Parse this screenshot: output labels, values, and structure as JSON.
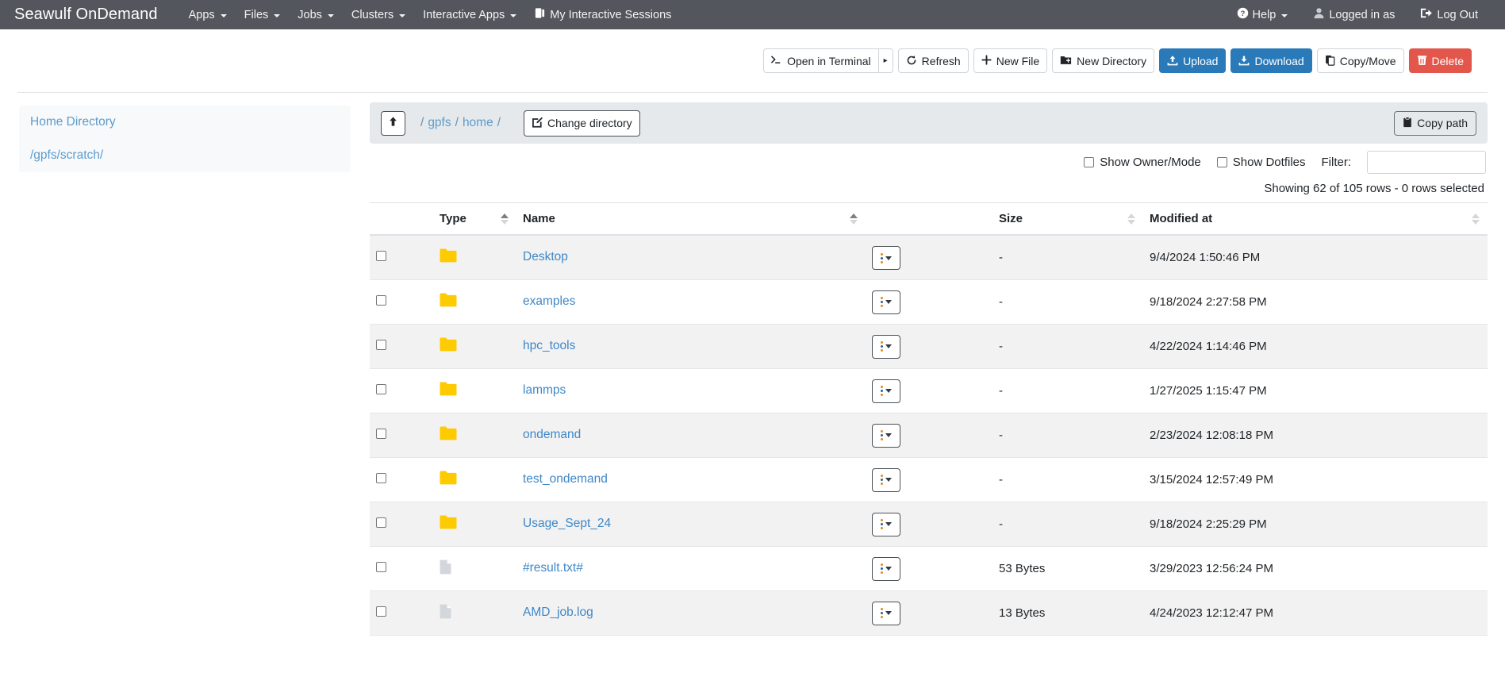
{
  "navbar": {
    "brand": "Seawulf OnDemand",
    "items": [
      {
        "label": "Apps",
        "has_caret": true,
        "icon": null
      },
      {
        "label": "Files",
        "has_caret": true,
        "icon": null
      },
      {
        "label": "Jobs",
        "has_caret": true,
        "icon": null
      },
      {
        "label": "Clusters",
        "has_caret": true,
        "icon": null
      },
      {
        "label": "Interactive Apps",
        "has_caret": true,
        "icon": null
      },
      {
        "label": "My Interactive Sessions",
        "has_caret": false,
        "icon": "sessions-icon"
      }
    ],
    "right_items": [
      {
        "label": "Help",
        "has_caret": true,
        "icon": "help-circle-icon"
      },
      {
        "label": "Logged in as",
        "has_caret": false,
        "icon": "user-icon"
      },
      {
        "label": "Log Out",
        "has_caret": false,
        "icon": "logout-icon"
      }
    ],
    "bg_color": "#53565c"
  },
  "toolbar": {
    "open_in_terminal": "Open in Terminal",
    "open_in_terminal_toggle": "▸",
    "refresh": "Refresh",
    "new_file": "New File",
    "new_directory": "New Directory",
    "upload": "Upload",
    "download": "Download",
    "copy_move": "Copy/Move",
    "delete": "Delete",
    "primary_color": "#2a7ab9",
    "danger_color": "#e3564c"
  },
  "sidebar": {
    "items": [
      {
        "label": "Home Directory"
      },
      {
        "label": "/gpfs/scratch/"
      }
    ]
  },
  "pathbar": {
    "up_icon": "arrow-up-icon",
    "crumbs": [
      {
        "sep": "/",
        "label": "gpfs"
      },
      {
        "sep": "/",
        "label": "home"
      },
      {
        "sep": "/",
        "label": ""
      }
    ],
    "change_directory": "Change directory",
    "copy_path": "Copy path"
  },
  "filters": {
    "show_owner_mode": "Show Owner/Mode",
    "show_owner_mode_checked": false,
    "show_dotfiles": "Show Dotfiles",
    "show_dotfiles_checked": false,
    "filter_label": "Filter:",
    "filter_value": "",
    "filter_placeholder": "",
    "rows_info": "Showing 62 of 105 rows - 0 rows selected"
  },
  "table": {
    "columns": [
      {
        "key": "checkbox",
        "label": "",
        "sortable": false
      },
      {
        "key": "type",
        "label": "Type",
        "sortable": true,
        "sorted": "asc"
      },
      {
        "key": "name",
        "label": "Name",
        "sortable": true,
        "sorted": "asc"
      },
      {
        "key": "actions",
        "label": "",
        "sortable": false
      },
      {
        "key": "size",
        "label": "Size",
        "sortable": true,
        "sorted": "none"
      },
      {
        "key": "modified",
        "label": "Modified at",
        "sortable": true,
        "sorted": "none"
      }
    ],
    "rows": [
      {
        "selected": false,
        "type": "folder",
        "name": "Desktop",
        "size": "-",
        "modified": "9/4/2024 1:50:46 PM"
      },
      {
        "selected": false,
        "type": "folder",
        "name": "examples",
        "size": "-",
        "modified": "9/18/2024 2:27:58 PM"
      },
      {
        "selected": false,
        "type": "folder",
        "name": "hpc_tools",
        "size": "-",
        "modified": "4/22/2024 1:14:46 PM"
      },
      {
        "selected": false,
        "type": "folder",
        "name": "lammps",
        "size": "-",
        "modified": "1/27/2025 1:15:47 PM"
      },
      {
        "selected": false,
        "type": "folder",
        "name": "ondemand",
        "size": "-",
        "modified": "2/23/2024 12:08:18 PM"
      },
      {
        "selected": false,
        "type": "folder",
        "name": "test_ondemand",
        "size": "-",
        "modified": "3/15/2024 12:57:49 PM"
      },
      {
        "selected": false,
        "type": "folder",
        "name": "Usage_Sept_24",
        "size": "-",
        "modified": "9/18/2024 2:25:29 PM"
      },
      {
        "selected": false,
        "type": "file",
        "name": "#result.txt#",
        "size": "53 Bytes",
        "modified": "3/29/2023 12:56:24 PM"
      },
      {
        "selected": false,
        "type": "file",
        "name": "AMD_job.log",
        "size": "13 Bytes",
        "modified": "4/24/2023 12:12:47 PM"
      }
    ]
  },
  "colors": {
    "folder": "#fdcb00",
    "file": "#d3d6da",
    "link": "#3f87c7",
    "row_stripe": "#f2f2f2"
  }
}
